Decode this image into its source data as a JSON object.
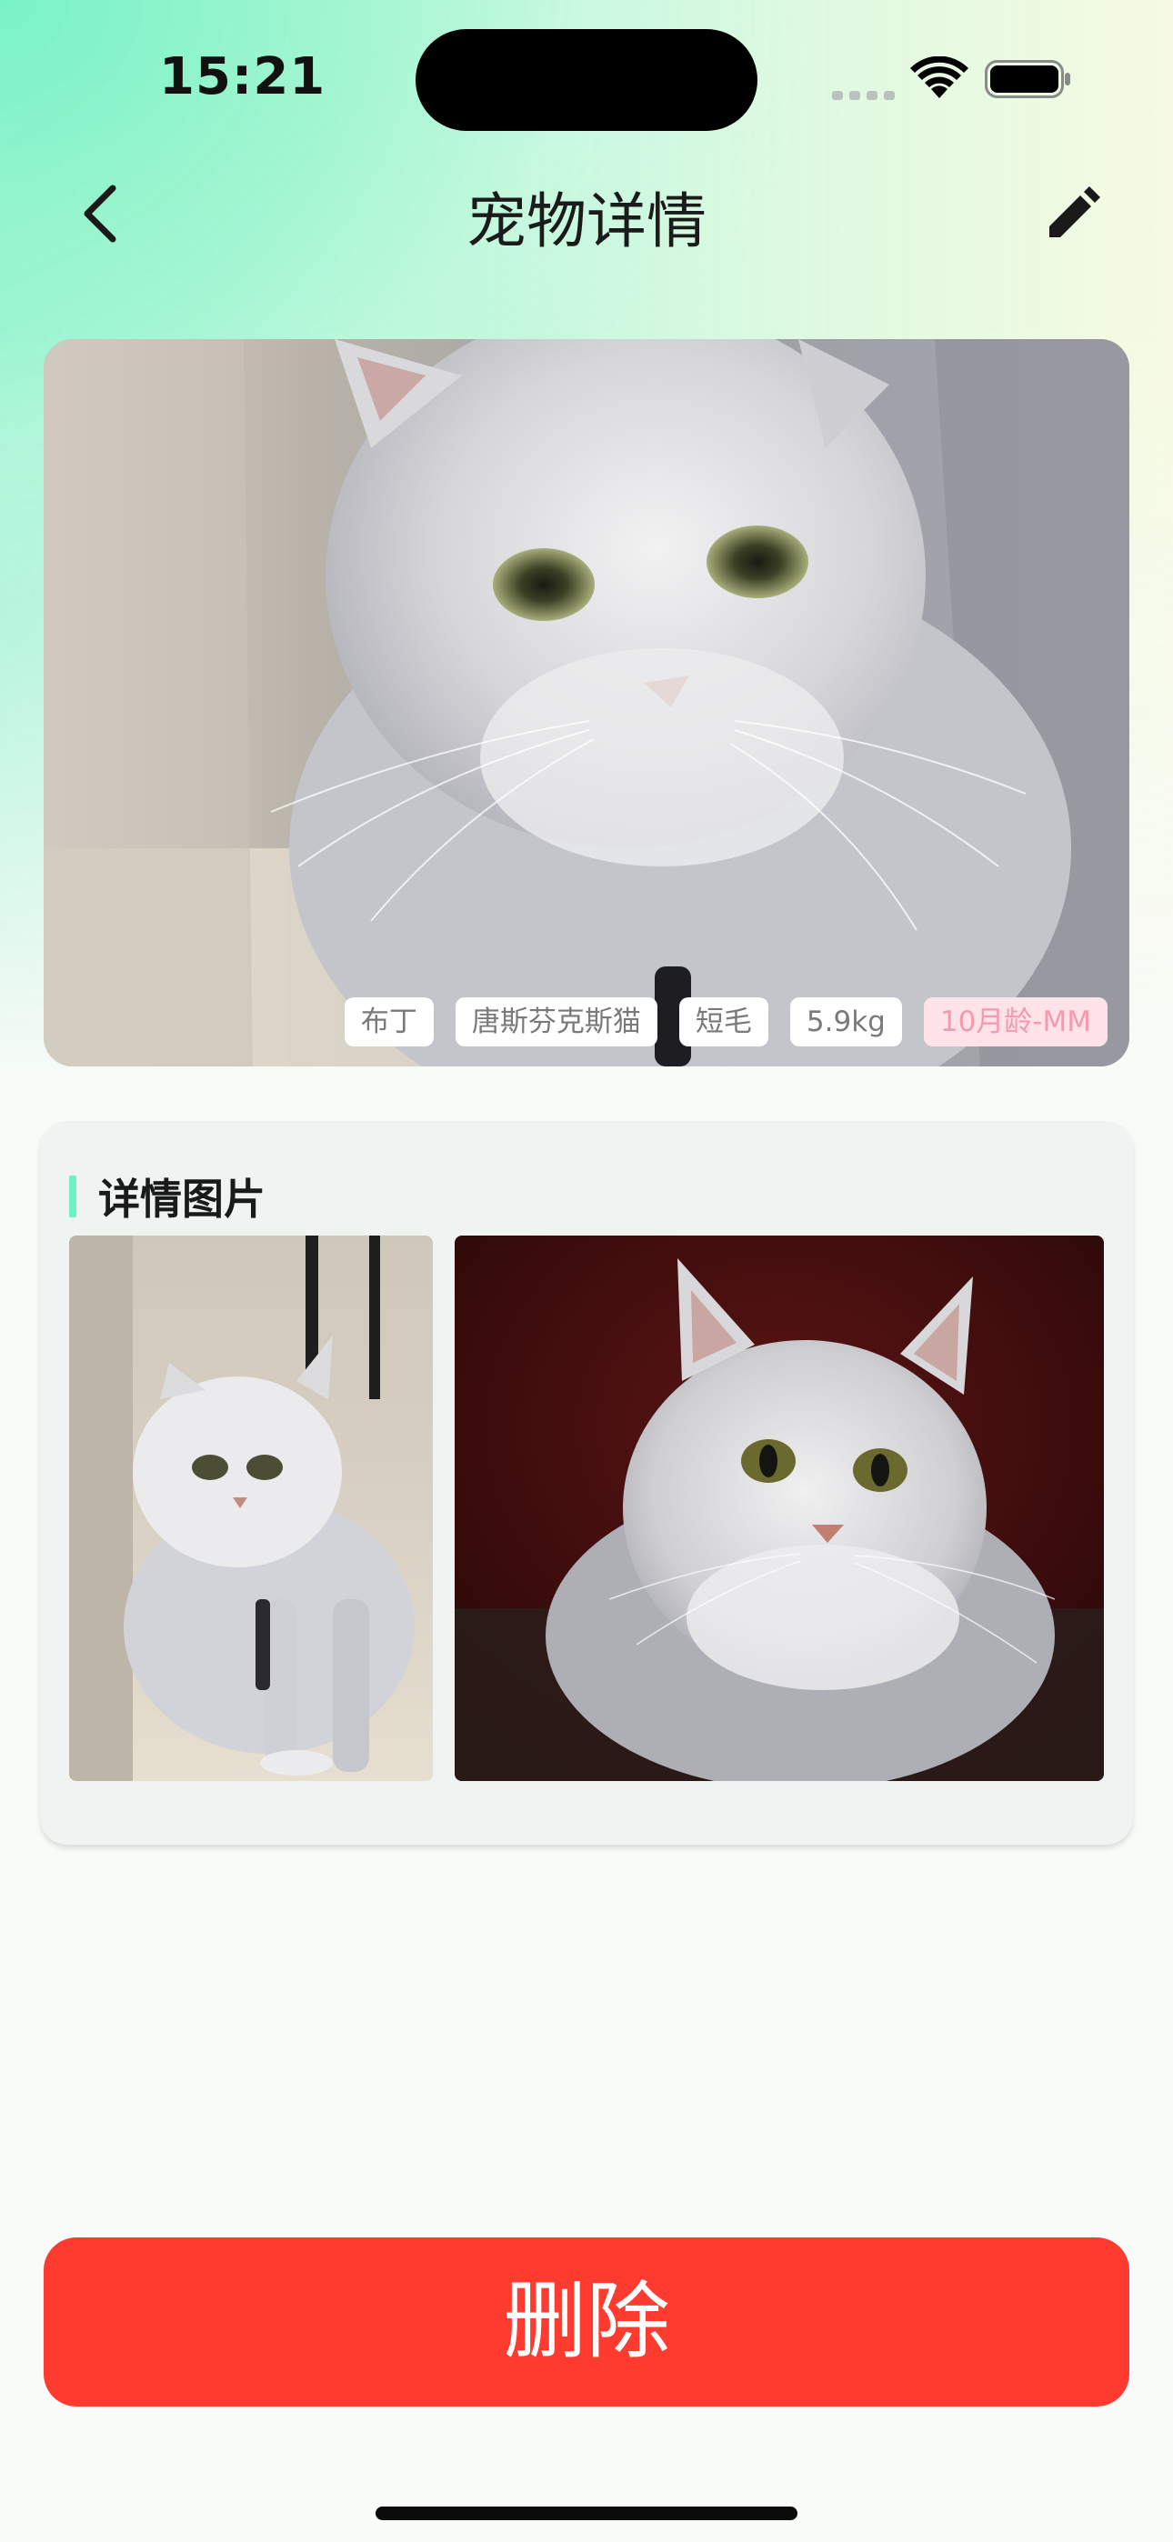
{
  "status_bar": {
    "time": "15:21"
  },
  "nav": {
    "title": "宠物详情",
    "back_icon": "chevron-left-icon",
    "edit_icon": "pencil-icon"
  },
  "hero": {
    "tags": [
      {
        "label": "布丁",
        "style": "normal"
      },
      {
        "label": "唐斯芬克斯猫",
        "style": "normal"
      },
      {
        "label": "短毛",
        "style": "normal"
      },
      {
        "label": "5.9kg",
        "style": "normal"
      },
      {
        "label": "10月龄-MM",
        "style": "pink"
      }
    ]
  },
  "detail_section": {
    "title": "详情图片"
  },
  "actions": {
    "delete_label": "删除"
  },
  "colors": {
    "accent_mint": "#6ef0c8",
    "delete_red": "#ff3b30",
    "tag_pink_bg": "#ffe3e8",
    "tag_pink_text": "#f59aac"
  }
}
